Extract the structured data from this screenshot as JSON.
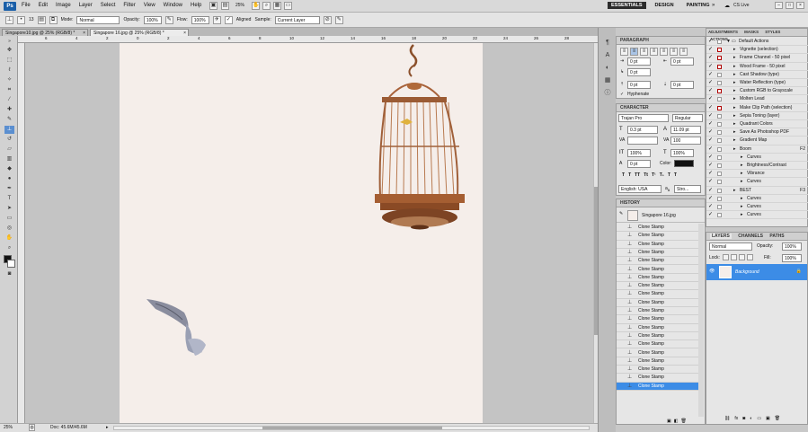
{
  "menubar": {
    "logo": "Ps",
    "items": [
      "File",
      "Edit",
      "Image",
      "Layer",
      "Select",
      "Filter",
      "View",
      "Window",
      "Help"
    ],
    "zoom": "25%",
    "workspaces": [
      "ESSENTIALS",
      "DESIGN",
      "PAINTING"
    ],
    "cs_live": "CS Live"
  },
  "options": {
    "brush_size": "13",
    "mode_label": "Mode:",
    "mode_value": "Normal",
    "opacity_label": "Opacity:",
    "opacity_value": "100%",
    "flow_label": "Flow:",
    "flow_value": "100%",
    "aligned_label": "Aligned",
    "sample_label": "Sample:",
    "sample_value": "Current Layer"
  },
  "tabs": [
    {
      "label": "Singapore10.jpg @ 25% (RGB/8) *"
    },
    {
      "label": "Singapore 16.jpg @ 25% (RGB/8) *"
    }
  ],
  "status": {
    "zoom": "25%",
    "doc": "Doc: 45.6M/45.6M"
  },
  "ruler_top_labels": [
    "6",
    "4",
    "2",
    "0",
    "2",
    "4",
    "6",
    "8",
    "10",
    "12",
    "14",
    "16",
    "18",
    "20",
    "22",
    "24",
    "26",
    "28"
  ],
  "paragraph": {
    "header": "PARAGRAPH",
    "v1": "0 pt",
    "v2": "0 pt",
    "v3": "0 pt",
    "v4": "0 pt",
    "v5": "0 pt",
    "hyphenate": "Hyphenate"
  },
  "character": {
    "header": "CHARACTER",
    "font": "Trajan Pro",
    "style": "Regular",
    "size": "0.3 pt",
    "leading": "11.09 pt",
    "kerning": "",
    "tracking": "100",
    "vscale": "100%",
    "hscale": "100%",
    "baseline": "0 pt",
    "color_label": "Color:",
    "styles": [
      "T",
      "T",
      "TT",
      "Tt",
      "T¹",
      "T₁",
      "T",
      "T"
    ],
    "language": "English: USA",
    "aa": "Stro..."
  },
  "history": {
    "header": "HISTORY",
    "snapshot": "Singapore 16.jpg",
    "items": [
      "Clone Stamp",
      "Clone Stamp",
      "Clone Stamp",
      "Clone Stamp",
      "Clone Stamp",
      "Clone Stamp",
      "Clone Stamp",
      "Clone Stamp",
      "Clone Stamp",
      "Clone Stamp",
      "Clone Stamp",
      "Clone Stamp",
      "Clone Stamp",
      "Clone Stamp",
      "Clone Stamp",
      "Clone Stamp",
      "Clone Stamp",
      "Clone Stamp",
      "Clone Stamp",
      "Clone Stamp"
    ]
  },
  "actions": {
    "tabs": [
      "ADJUSTMENTS",
      "MASKS",
      "STYLES",
      "ACTIONS"
    ],
    "rows": [
      {
        "label": "Default Actions",
        "indent": 0,
        "folder": true,
        "key": "",
        "red": false
      },
      {
        "label": "Vignette (selection)",
        "indent": 1,
        "key": "",
        "red": true
      },
      {
        "label": "Frame Channel - 50 pixel",
        "indent": 1,
        "key": "",
        "red": true
      },
      {
        "label": "Wood Frame - 50 pixel",
        "indent": 1,
        "key": "",
        "red": true
      },
      {
        "label": "Cast Shadow (type)",
        "indent": 1,
        "key": "",
        "red": false
      },
      {
        "label": "Water Reflection (type)",
        "indent": 1,
        "key": "",
        "red": false
      },
      {
        "label": "Custom RGB to Grayscale",
        "indent": 1,
        "key": "",
        "red": true
      },
      {
        "label": "Molten Lead",
        "indent": 1,
        "key": "",
        "red": false
      },
      {
        "label": "Make Clip Path (selection)",
        "indent": 1,
        "key": "",
        "red": true
      },
      {
        "label": "Sepia Toning (layer)",
        "indent": 1,
        "key": "",
        "red": false
      },
      {
        "label": "Quadrant Colors",
        "indent": 1,
        "key": "",
        "red": false
      },
      {
        "label": "Save As Photoshop PDF",
        "indent": 1,
        "key": "",
        "red": false
      },
      {
        "label": "Gradient Map",
        "indent": 1,
        "key": "",
        "red": false
      },
      {
        "label": "Boom",
        "indent": 1,
        "key": "F2",
        "red": false
      },
      {
        "label": "Curves",
        "indent": 2,
        "key": "",
        "red": false
      },
      {
        "label": "Brightness/Contrast",
        "indent": 2,
        "key": "",
        "red": false
      },
      {
        "label": "Vibrance",
        "indent": 2,
        "key": "",
        "red": false
      },
      {
        "label": "Curves",
        "indent": 2,
        "key": "",
        "red": false
      },
      {
        "label": "BEST",
        "indent": 1,
        "key": "F3",
        "red": false
      },
      {
        "label": "Curves",
        "indent": 2,
        "key": "",
        "red": false
      },
      {
        "label": "Curves",
        "indent": 2,
        "key": "",
        "red": false
      },
      {
        "label": "Curves",
        "indent": 2,
        "key": "",
        "red": false
      }
    ]
  },
  "layers": {
    "tabs": [
      "LAYERS",
      "CHANNELS",
      "PATHS"
    ],
    "blend": "Normal",
    "opacity_label": "Opacity:",
    "opacity": "100%",
    "lock_label": "Lock:",
    "fill_label": "Fill:",
    "fill": "100%",
    "layer_name": "Background"
  },
  "colors": {
    "selection": "#3c8ce6",
    "canvas": "#f5eeea",
    "cage": "#b06a3a"
  }
}
